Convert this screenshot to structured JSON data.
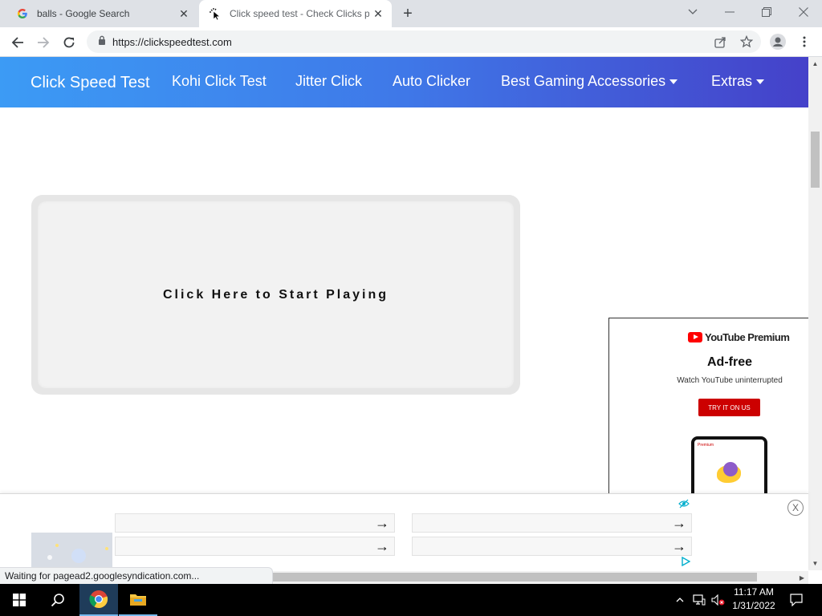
{
  "browser": {
    "tabs": [
      {
        "title": "balls - Google Search",
        "favicon": "google-g-icon",
        "active": false
      },
      {
        "title": "Click speed test - Check Clicks per",
        "favicon": "cursor-click-icon",
        "active": true
      }
    ],
    "new_tab_icon": "plus-icon",
    "window_controls": [
      "chevron-down-icon",
      "minimize-icon",
      "restore-icon",
      "close-icon"
    ],
    "url": "https://clickspeedtest.com",
    "status_text": "Waiting for pagead2.googlesyndication.com..."
  },
  "site": {
    "brand": "Click Speed Test",
    "nav": [
      {
        "label": "Kohi Click Test",
        "dropdown": false
      },
      {
        "label": "Jitter Click",
        "dropdown": false
      },
      {
        "label": "Auto Clicker",
        "dropdown": false
      },
      {
        "label": "Best Gaming Accessories",
        "dropdown": true
      },
      {
        "label": "Extras",
        "dropdown": true
      }
    ],
    "click_area_label": "Click Here to Start Playing"
  },
  "ads": {
    "youtube": {
      "brand": "YouTube Premium",
      "phone_header": "Premium",
      "headline": "Ad-free",
      "subline": "Watch YouTube uninterrupted",
      "cta": "TRY IT ON US"
    },
    "close_label": "X",
    "arrow": "→"
  },
  "taskbar": {
    "time": "11:17 AM",
    "date": "1/31/2022",
    "accent": "#76b9ed"
  },
  "colors": {
    "nav_gradient_start": "#3c9bf5",
    "nav_gradient_end": "#4541c9",
    "yt_red": "#cc0000"
  }
}
